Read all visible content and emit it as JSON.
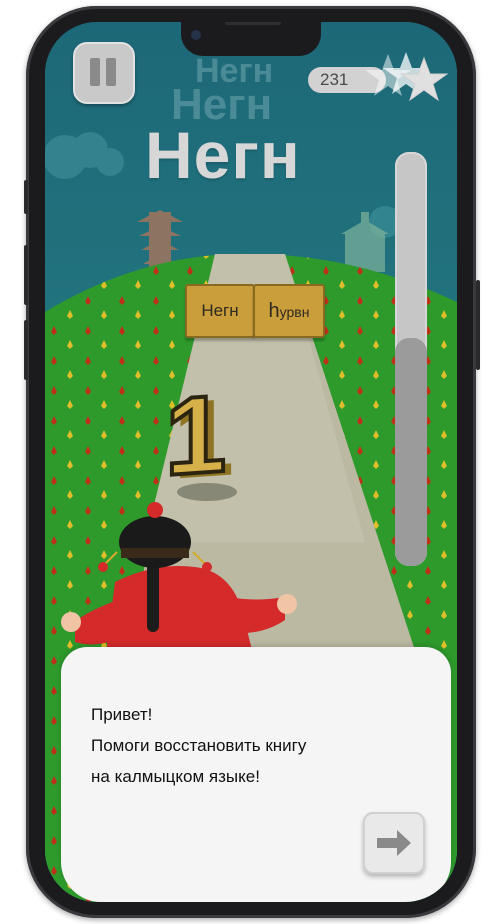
{
  "game": {
    "score": "231",
    "target_word": "Негн",
    "ghost_words": [
      "Негн",
      "Негн"
    ],
    "progress_fraction": 0.55,
    "cards": [
      {
        "text": "Негн"
      },
      {
        "text_big": "h",
        "text_small": "урвн"
      }
    ],
    "number_display": "1"
  },
  "dialog": {
    "lines": [
      "Привет!",
      "Помоги восстановить книгу",
      "на калмыцком языке!"
    ],
    "next_icon": "arrow-right-icon"
  },
  "colors": {
    "sky": "#1f6c7a",
    "grass": "#2f9a2b",
    "road": "#bdbba3",
    "card": "#c99e3b",
    "dialog_bg": "#f5f5f5"
  }
}
